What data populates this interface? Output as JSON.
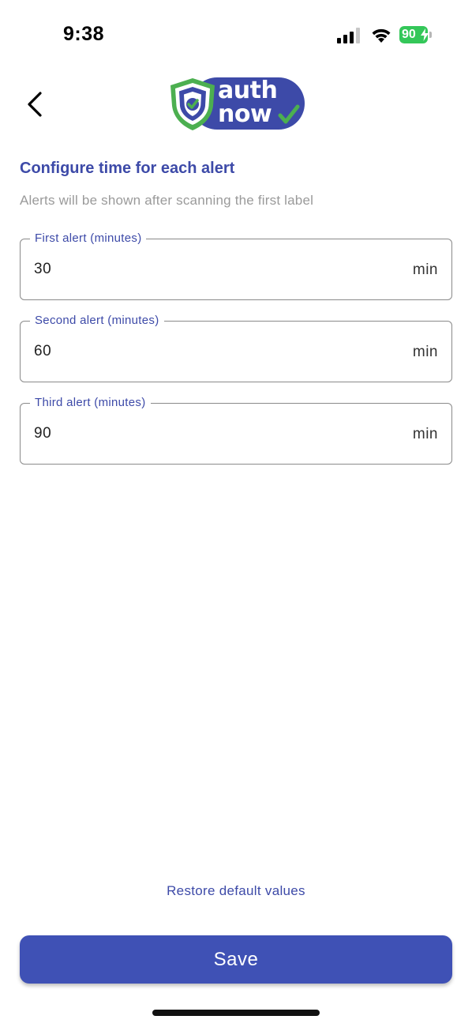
{
  "status_bar": {
    "time": "9:38",
    "battery_level": "90",
    "icons": [
      "cellular-signal-icon",
      "wifi-icon",
      "battery-charging-icon"
    ]
  },
  "header": {
    "back_icon": "chevron-left-icon",
    "logo": {
      "line1": "auth",
      "line2": "now",
      "icon": "shield-check-icon"
    }
  },
  "content": {
    "title": "Configure time for each alert",
    "subtitle": "Alerts will be shown after scanning the first label",
    "fields": [
      {
        "label": "First alert (minutes)",
        "value": "30",
        "suffix": "min"
      },
      {
        "label": "Second alert (minutes)",
        "value": "60",
        "suffix": "min"
      },
      {
        "label": "Third alert (minutes)",
        "value": "90",
        "suffix": "min"
      }
    ]
  },
  "footer": {
    "restore_label": "Restore default values",
    "save_label": "Save"
  },
  "colors": {
    "primary": "#3f51b5",
    "title": "#3d4aa8",
    "logo_green": "#4caf50",
    "battery_green": "#34c759",
    "subtitle_gray": "#9a9a9a"
  }
}
